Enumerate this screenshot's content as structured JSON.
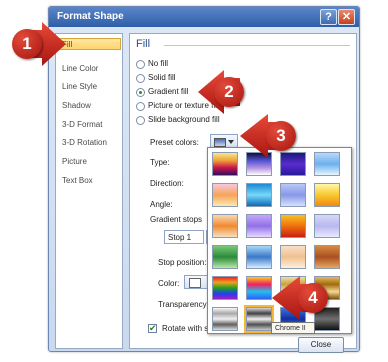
{
  "dialog": {
    "title": "Format Shape",
    "help": "?",
    "close": "✕",
    "close_button": "Close"
  },
  "nav": {
    "items": [
      "Fill",
      "Line Color",
      "Line Style",
      "Shadow",
      "3-D Format",
      "3-D Rotation",
      "Picture",
      "Text Box"
    ]
  },
  "fill": {
    "heading": "Fill",
    "options": [
      "No fill",
      "Solid fill",
      "Gradient fill",
      "Picture or texture fill",
      "Slide background fill"
    ],
    "selected": "Gradient fill",
    "preset_label": "Preset colors:",
    "type_label": "Type:",
    "direction_label": "Direction:",
    "angle_label": "Angle:",
    "stops_label": "Gradient stops",
    "stop_value": "Stop 1",
    "stop_position_label": "Stop position:",
    "color_label": "Color:",
    "transparency_label": "Transparency:",
    "rotate_label": "Rotate with shape",
    "rotate_checked": true
  },
  "tooltip": "Chrome II",
  "callouts": [
    "1",
    "2",
    "3",
    "4"
  ],
  "presets": [
    [
      "#f5e88a",
      "#f0a43a",
      "#c8144e",
      "#30105a"
    ],
    [
      "#0e1030",
      "#5050d0",
      "#b090e0",
      "#ffffff"
    ]
  ]
}
